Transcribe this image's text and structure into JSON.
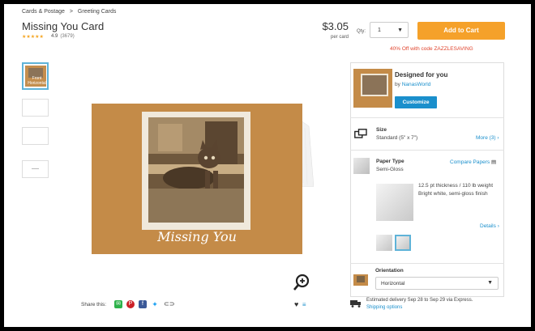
{
  "breadcrumb": {
    "items": [
      "Cards & Postage",
      "Greeting Cards"
    ],
    "separator": ">"
  },
  "product": {
    "title": "Missing You Card",
    "stars": "★★★★★",
    "rating": "4.9",
    "review_count": "(3679)"
  },
  "pricing": {
    "price": "$3.05",
    "per": "per card"
  },
  "quantity": {
    "label": "Qty:",
    "value": "1"
  },
  "cart": {
    "label": "Add to Cart"
  },
  "promo": "40% Off with code ZAZZLESAVING",
  "thumbnails": {
    "first_label": "Front Horizontal"
  },
  "card": {
    "text": "Missing You"
  },
  "share": {
    "label": "Share this:",
    "icons": [
      "email-icon",
      "pinterest-icon",
      "facebook-icon",
      "twitter-icon",
      "link-icon"
    ]
  },
  "designed": {
    "title": "Designed for you",
    "by_prefix": "by",
    "by_name": "NanasWorld",
    "button": "Customize"
  },
  "size": {
    "label": "Size",
    "value": "Standard (5\" x 7\")",
    "more": "More (3)",
    "more_arrow": "›"
  },
  "paper": {
    "label": "Paper Type",
    "value": "Semi-Gloss",
    "compare": "Compare Papers",
    "desc_line1": "12.5 pt thickness / 110 lb weight",
    "desc_line2": "Bright white, semi-gloss finish",
    "details": "Details",
    "details_arrow": "›"
  },
  "orientation": {
    "label": "Orientation",
    "value": "Horizontal"
  },
  "delivery": {
    "estimate": "Estimated delivery Sep 28 to Sep 29 via Express.",
    "options": "Shipping options"
  },
  "colors": {
    "accent": "#f5a12a",
    "link": "#1a8fcc",
    "promo": "#e0452e",
    "card": "#c48b48"
  }
}
